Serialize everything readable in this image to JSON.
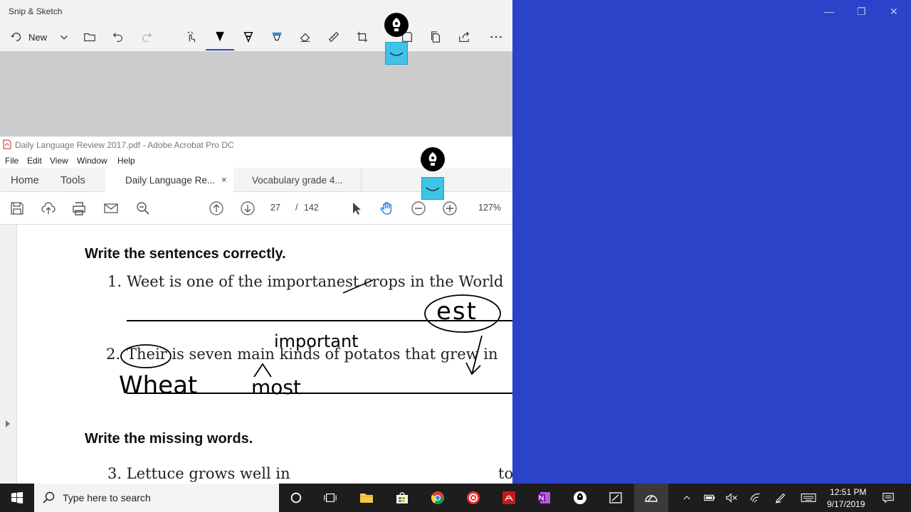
{
  "snip": {
    "title": "Snip & Sketch",
    "new_label": "New",
    "tools": [
      "touch-writing",
      "ballpoint-pen",
      "pencil",
      "highlighter",
      "eraser",
      "ruler",
      "crop",
      "save",
      "copy",
      "share",
      "more"
    ]
  },
  "acrobat": {
    "title": "Daily Language Review 2017.pdf - Adobe Acrobat Pro DC",
    "menu": [
      "File",
      "Edit",
      "View",
      "Window",
      "Help"
    ],
    "tab_home": "Home",
    "tab_tools": "Tools",
    "tab_doc1": "Daily Language Re...",
    "tab_doc1_close": "×",
    "tab_doc2": "Vocabulary grade 4...",
    "page_current": "27",
    "page_sep": "/",
    "page_total": "142",
    "zoom": "127%"
  },
  "document": {
    "heading1": "Write the sentences correctly.",
    "s1_num": "1.",
    "s1_text": "Weet is one of the importanest crops in the World",
    "s2_num": "2.",
    "s2_text": "Their is seven main kinds of potatos that grew in",
    "heading2": "Write the missing words.",
    "s3_text": "3. Lettuce grows well in",
    "s3_tail": "to",
    "hand_est": "est",
    "hand_important": "important",
    "hand_wheat": "Wheat",
    "hand_most": "most"
  },
  "taskbar": {
    "search_placeholder": "Type here to search",
    "time": "12:51 PM",
    "date": "9/17/2019"
  },
  "colors": {
    "desktop": "#2b43c9",
    "accent": "#2b43c9",
    "taskbar": "#1d1d1d"
  }
}
